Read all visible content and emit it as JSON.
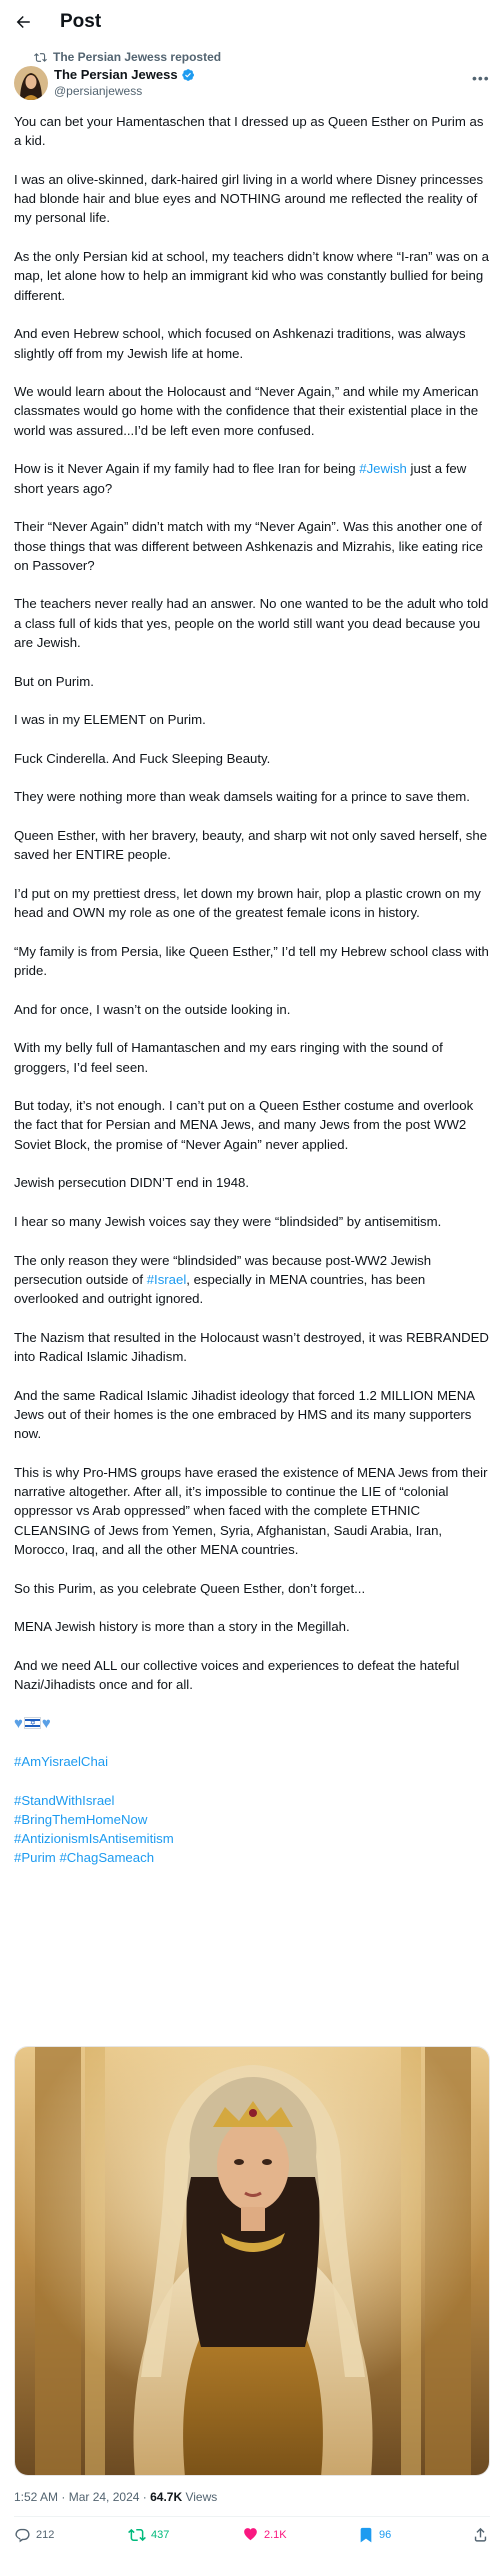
{
  "header": {
    "title": "Post",
    "back_icon": "arrow-left-icon"
  },
  "repost": {
    "label": "The Persian Jewess reposted",
    "icon": "repost-icon"
  },
  "author": {
    "name": "The Persian Jewess",
    "handle": "@persianjewess",
    "verified": true,
    "verified_color": "#1d9bf0",
    "more_label": "•••"
  },
  "post": {
    "p1": "You can bet your Hamentaschen that I dressed up as Queen Esther on Purim as a kid.",
    "p2": "I was an olive-skinned, dark-haired girl living in a world where Disney princesses had blonde hair and blue eyes and NOTHING around me reflected the reality of my personal life.",
    "p3": "As the only Persian kid at school, my teachers didn’t know where “I-ran” was on a map, let alone how to help an immigrant kid who was constantly bullied for being different.",
    "p4": "And even Hebrew school, which focused on Ashkenazi traditions, was always slightly off from my Jewish life at home.",
    "p5": "We would learn about the Holocaust and “Never Again,” and while my American classmates would go home with the confidence that their existential place in the world was assured...I’d be left even more confused.",
    "p6_pre": "How is it Never Again if my family had to flee Iran for being ",
    "p6_tag": "#Jewish",
    "p6_post": " just a few short years ago?",
    "p7": "Their “Never Again” didn’t match with my “Never Again”. Was this another one of those things that was different between Ashkenazis and Mizrahis, like eating rice on Passover?",
    "p8": "The teachers never really had an answer. No one wanted to be the adult who told a class full of kids that yes, people on the world still want you dead because you are Jewish.",
    "p9": "But on Purim.",
    "p10": "I was in my ELEMENT on Purim.",
    "p11": "Fuck Cinderella. And Fuck Sleeping Beauty.",
    "p12": "They were nothing more than weak damsels waiting for a prince to save them.",
    "p13": "Queen Esther, with her bravery, beauty, and sharp wit not only saved herself, she saved her ENTIRE people.",
    "p14": "I’d put on my prettiest dress, let down my brown hair, plop a plastic crown on my head and OWN my role as one of the greatest female icons in history.",
    "p15": "“My family is from Persia, like Queen Esther,” I’d tell my Hebrew school class with pride.",
    "p16": "And for once, I wasn’t on the outside looking in.",
    "p17": "With my belly full of Hamantaschen and my ears ringing with the sound of groggers, I’d feel seen.",
    "p18": "But today, it’s not enough. I can’t put on a Queen Esther costume and overlook the fact that for Persian and MENA Jews, and many Jews from the post WW2 Soviet Block, the promise of “Never Again” never applied.",
    "p19": "Jewish persecution DIDN’T end in 1948.",
    "p20": "I hear so many Jewish voices say they were “blindsided” by antisemitism.",
    "p21_pre": "The only reason they were “blindsided” was because post-WW2 Jewish persecution outside of ",
    "p21_tag": "#Israel",
    "p21_post": ", especially in MENA countries, has been overlooked and outright ignored.",
    "p22": "The Nazism that resulted in the Holocaust wasn’t destroyed, it was REBRANDED into Radical Islamic Jihadism.",
    "p23": "And the same Radical Islamic Jihadist ideology that forced 1.2 MILLION MENA Jews out of their homes is the one embraced by HMS and its many supporters now.",
    "p24": "This is why Pro-HMS groups have erased the existence of MENA Jews from their narrative altogether. After all, it’s impossible to continue the LIE of “colonial oppressor vs Arab oppressed” when faced with the complete ETHNIC CLEANSING of Jews from Yemen, Syria, Afghanistan, Saudi Arabia, Iran, Morocco, Iraq, and all the other MENA countries.",
    "p25": "So this Purim, as you celebrate Queen Esther, don’t forget...",
    "p26": "MENA Jewish history is more than a story in the Megillah.",
    "p27": "And we need ALL our collective voices and experiences to defeat the hateful Nazi/Jihadists once and for all.",
    "emoji": {
      "heart1": "heart-icon",
      "flag": "israel-flag-icon",
      "heart2": "heart-icon",
      "heart_color": "#5aa0e6"
    },
    "hashtags": {
      "h1": "#AmYisraelChai",
      "h2": "#StandWithIsrael",
      "h3": "#BringThemHomeNow",
      "h4": "#AntizionismIsAntisemitism",
      "h5a": "#Purim",
      "h5b": "#ChagSameach"
    },
    "link_color": "#1d9bf0"
  },
  "image": {
    "subject": "queen-esther-portrait"
  },
  "meta": {
    "time": "1:52 AM",
    "sep": " · ",
    "date": "Mar 24, 2024",
    "views_count": "64.7K",
    "views_label": " Views"
  },
  "actions": {
    "reply": {
      "icon": "reply-icon",
      "count": "212"
    },
    "repost": {
      "icon": "repost-icon",
      "count": "437",
      "color": "#00ba7c"
    },
    "like": {
      "icon": "heart-icon",
      "count": "2.1K",
      "color": "#f91880"
    },
    "bookmark": {
      "icon": "bookmark-icon",
      "count": "96",
      "color": "#1d9bf0"
    },
    "share": {
      "icon": "share-icon"
    }
  }
}
